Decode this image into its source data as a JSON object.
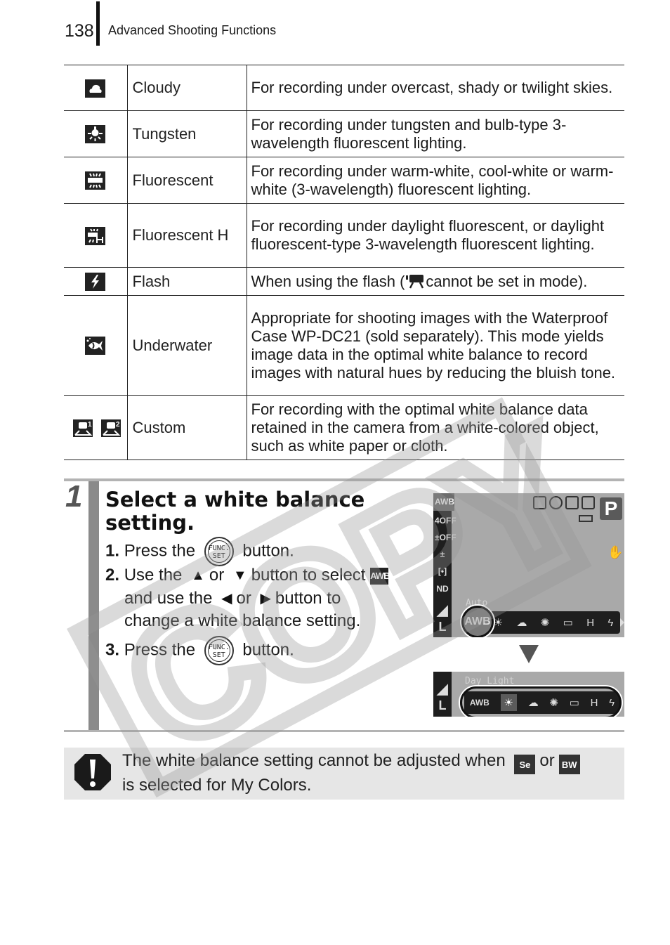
{
  "header": {
    "page_number": "138",
    "section_title": "Advanced Shooting Functions"
  },
  "wb_table": {
    "rows": [
      {
        "icon": "cloudy-icon",
        "name": "Cloudy",
        "description": "For recording under overcast, shady or twilight skies."
      },
      {
        "icon": "tungsten-icon",
        "name": "Tungsten",
        "description": "For recording under tungsten and bulb-type 3-wavelength fluorescent lighting."
      },
      {
        "icon": "fluorescent-icon",
        "name": "Fluorescent",
        "description": "For recording under warm-white, cool-white or warm-white (3-wavelength) fluorescent lighting."
      },
      {
        "icon": "fluorescent-h-icon",
        "name": "Fluorescent H",
        "description": "For recording under daylight fluorescent, or daylight fluorescent-type 3-wavelength fluorescent lighting."
      },
      {
        "icon": "flash-icon",
        "name": "Flash",
        "description_before": "When using the flash (",
        "description_after": "cannot be set in mode)."
      },
      {
        "icon": "underwater-icon",
        "name": "Underwater",
        "description": "Appropriate for shooting images with the Waterproof Case WP-DC21 (sold separately). This mode yields image data in the optimal white balance to record images with natural hues by reducing the bluish tone."
      },
      {
        "icon": "custom-icon",
        "name": "Custom",
        "description": "For recording with the optimal white balance data retained in the camera from a white-colored object, such as white paper or cloth."
      }
    ]
  },
  "step": {
    "number": "1",
    "heading": "Select a white balance setting.",
    "instructions": [
      {
        "num": "1.",
        "before": "Press the",
        "after": "button."
      },
      {
        "num": "2.",
        "line1_a": "Use the",
        "or1": "or",
        "line1_b": "button to select",
        "line2_a": "and use the",
        "or2": "or",
        "line2_b": "button to",
        "line3": "change a white balance setting."
      },
      {
        "num": "3.",
        "before": "Press the",
        "after": "button."
      }
    ],
    "func_button": {
      "top": "FUNC.",
      "bottom": "SET"
    },
    "awb_label": "AWB"
  },
  "camera_screen_1": {
    "mode": "P",
    "menu_top": "AWB",
    "menu_items": [
      "4OFF",
      "±OFF",
      "±",
      "[•]",
      "ND",
      "◢",
      "L"
    ],
    "current_label": "Auto",
    "selected": "AWB",
    "strip": [
      "☀",
      "☁",
      "✺",
      "▭",
      "H",
      "ϟ"
    ]
  },
  "camera_screen_2": {
    "current_label": "Day Light",
    "strip": [
      "AWB",
      "☀",
      "☁",
      "✺",
      "▭",
      "H",
      "ϟ"
    ],
    "selected_index": 1
  },
  "note": {
    "text_before": "The white balance setting cannot be adjusted when",
    "icon1": "Se",
    "or": "or",
    "icon2": "BW",
    "text_after": "is selected for My Colors."
  },
  "watermark": {
    "text": "COPY"
  }
}
